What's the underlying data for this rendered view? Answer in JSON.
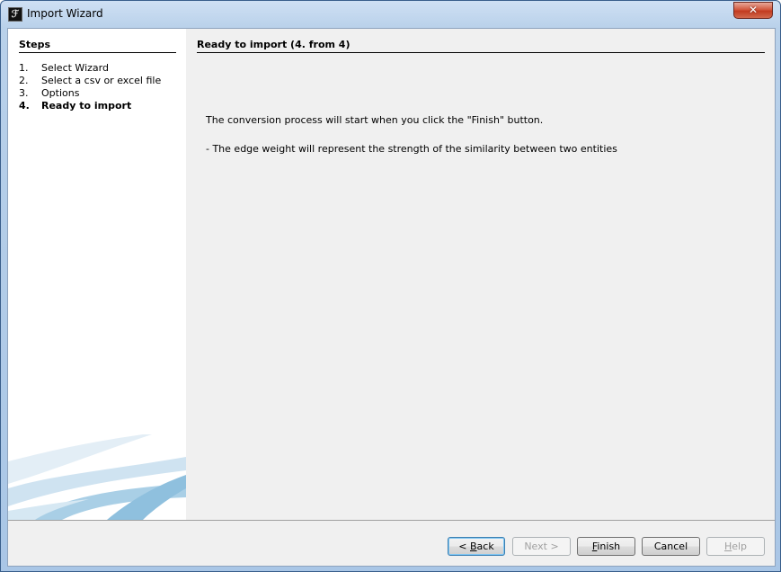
{
  "window": {
    "title": "Import Wizard",
    "icon": "app-logo-icon",
    "close_label": "✕"
  },
  "steps": {
    "title": "Steps",
    "items": [
      {
        "num": "1.",
        "label": "Select Wizard",
        "active": false
      },
      {
        "num": "2.",
        "label": "Select a csv or excel file",
        "active": false
      },
      {
        "num": "3.",
        "label": "Options",
        "active": false
      },
      {
        "num": "4.",
        "label": "Ready to import",
        "active": true
      }
    ]
  },
  "content": {
    "title": "Ready to import (4. from 4)",
    "message1": "The conversion process will start when you click the \"Finish\" button.",
    "message2": "- The edge weight will represent the strength of the similarity between two entities"
  },
  "buttons": {
    "back": {
      "mnemonic": "B",
      "rest": "ack",
      "prefix": "< ",
      "enabled": true,
      "default": true
    },
    "next": {
      "label": "Next >",
      "enabled": false
    },
    "finish": {
      "mnemonic": "F",
      "rest": "inish",
      "enabled": true
    },
    "cancel": {
      "label": "Cancel",
      "enabled": true
    },
    "help": {
      "mnemonic": "H",
      "rest": "elp",
      "enabled": false
    }
  }
}
